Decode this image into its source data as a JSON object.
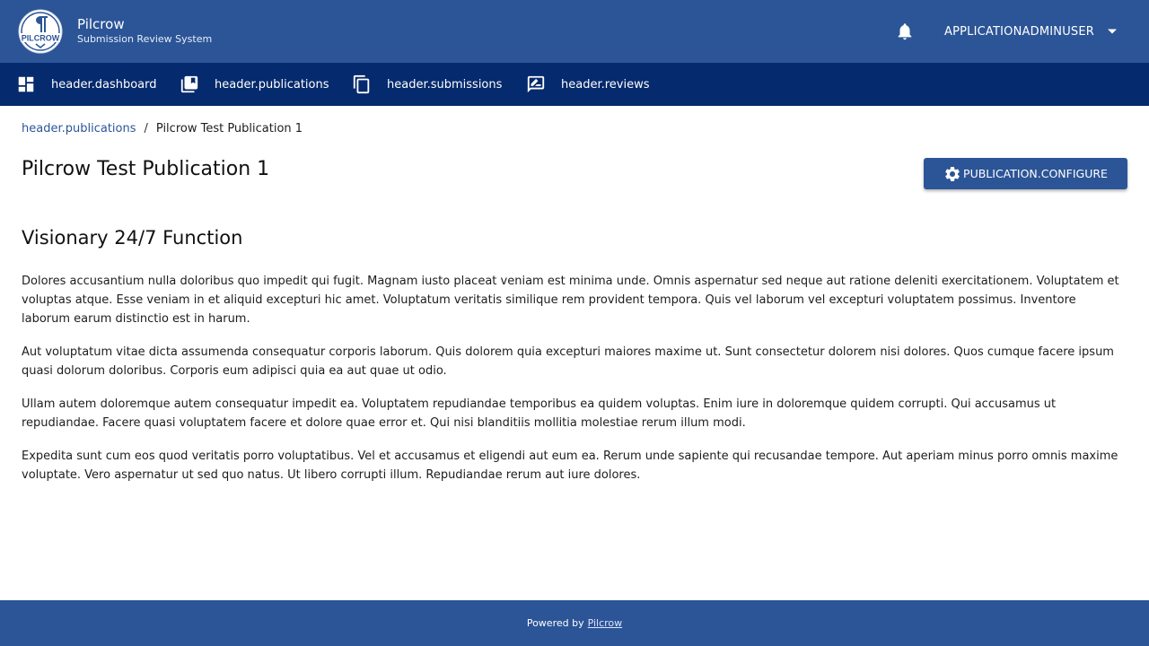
{
  "brand": {
    "name": "Pilcrow",
    "subtitle": "Submission Review System",
    "logo_text": "PILCROW"
  },
  "header": {
    "notifications_icon": "bell-icon",
    "user_name": "APPLICATIONADMINUSER",
    "user_menu_icon": "caret-down-icon"
  },
  "nav": {
    "items": [
      {
        "label": "header.dashboard",
        "icon": "dashboard-icon"
      },
      {
        "label": "header.publications",
        "icon": "library-books-icon"
      },
      {
        "label": "header.submissions",
        "icon": "copy-files-icon"
      },
      {
        "label": "header.reviews",
        "icon": "rate-review-icon"
      }
    ]
  },
  "breadcrumb": {
    "link": "header.publications",
    "separator": "/",
    "current": "Pilcrow Test Publication 1"
  },
  "page": {
    "title": "Pilcrow Test Publication 1",
    "configure_label": "PUBLICATION.CONFIGURE",
    "configure_icon": "gear-icon"
  },
  "section": {
    "title": "Visionary 24/7 Function",
    "paragraphs": [
      "Dolores accusantium nulla doloribus quo impedit qui fugit. Magnam iusto placeat veniam est minima unde. Omnis aspernatur sed neque aut ratione deleniti exercitationem. Voluptatem et voluptas atque. Esse veniam in et aliquid excepturi hic amet. Voluptatum veritatis similique rem provident tempora. Quis vel laborum vel excepturi voluptatem possimus. Inventore laborum earum distinctio est in harum.",
      "Aut voluptatum vitae dicta assumenda consequatur corporis laborum. Quis dolorem quia excepturi maiores maxime ut. Sunt consectetur dolorem nisi dolores. Quos cumque facere ipsum quasi dolorum doloribus. Corporis eum adipisci quia ea aut quae ut odio.",
      "Ullam autem doloremque autem consequatur impedit ea. Voluptatem repudiandae temporibus ea quidem voluptas. Enim iure in doloremque quidem corrupti. Qui accusamus ut repudiandae. Facere quasi voluptatem facere et dolore quae error et. Qui nisi blanditiis mollitia molestiae rerum illum modi.",
      "Expedita sunt cum eos quod veritatis porro voluptatibus. Vel et accusamus et eligendi aut eum ea. Rerum unde sapiente qui recusandae tempore. Aut aperiam minus porro omnis maxime voluptate. Vero aspernatur ut sed quo natus. Ut libero corrupti illum. Repudiandae rerum aut iure dolores."
    ]
  },
  "footer": {
    "powered_by": "Powered by",
    "link": "Pilcrow"
  },
  "colors": {
    "primary": "#2c5597",
    "nav_dark": "#052a6d",
    "white": "#ffffff"
  }
}
